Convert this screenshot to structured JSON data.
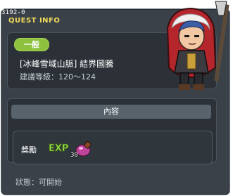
{
  "window": {
    "quest_id": "3192-0",
    "title": "QUEST INFO"
  },
  "quest": {
    "category": "一般",
    "name": "[冰峰雪域山脈] 結界圖騰",
    "level_requirement": "建議等級：120〜124"
  },
  "content": {
    "header": "內容",
    "reward_label": "獎勵",
    "rewards": [
      {
        "icon": "exp-icon",
        "label": "EXP"
      },
      {
        "icon": "potion-icon",
        "quantity": "30"
      }
    ]
  },
  "status": {
    "text": "狀態：可開始"
  },
  "colors": {
    "panel": "#3a4148",
    "title": "#f2dc5a",
    "badge": "#8ec23e"
  }
}
